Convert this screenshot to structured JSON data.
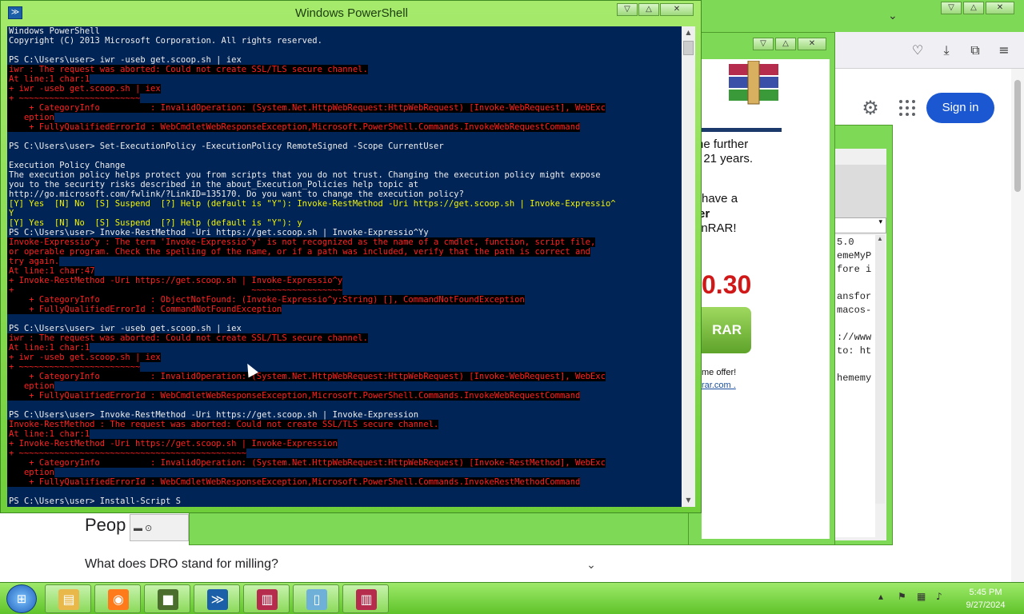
{
  "powershell": {
    "title": "Windows PowerShell",
    "icon": "powershell-icon",
    "lines": [
      {
        "t": "w",
        "text": "Windows PowerShell"
      },
      {
        "t": "w",
        "text": "Copyright (C) 2013 Microsoft Corporation. All rights reserved."
      },
      {
        "t": "w",
        "text": ""
      },
      {
        "t": "w",
        "text": "PS C:\\Users\\user> iwr -useb get.scoop.sh | iex"
      },
      {
        "t": "e",
        "text": "iwr : The request was aborted: Could not create SSL/TLS secure channel."
      },
      {
        "t": "e",
        "text": "At line:1 char:1"
      },
      {
        "t": "e",
        "text": "+ iwr -useb get.scoop.sh | iex"
      },
      {
        "t": "e",
        "text": "+ ~~~~~~~~~~~~~~~~~~~~~~~~"
      },
      {
        "t": "e",
        "text": "    + CategoryInfo          : InvalidOperation: (System.Net.HttpWebRequest:HttpWebRequest) [Invoke-WebRequest], WebExc"
      },
      {
        "t": "e",
        "text": "   eption"
      },
      {
        "t": "e",
        "text": "    + FullyQualifiedErrorId : WebCmdletWebResponseException,Microsoft.PowerShell.Commands.InvokeWebRequestCommand"
      },
      {
        "t": "w",
        "text": ""
      },
      {
        "t": "w",
        "text": "PS C:\\Users\\user> Set-ExecutionPolicy -ExecutionPolicy RemoteSigned -Scope CurrentUser"
      },
      {
        "t": "w",
        "text": ""
      },
      {
        "t": "w",
        "text": "Execution Policy Change"
      },
      {
        "t": "w",
        "text": "The execution policy helps protect you from scripts that you do not trust. Changing the execution policy might expose"
      },
      {
        "t": "w",
        "text": "you to the security risks described in the about_Execution_Policies help topic at"
      },
      {
        "t": "w",
        "text": "http://go.microsoft.com/fwlink/?LinkID=135170. Do you want to change the execution policy?"
      },
      {
        "t": "y",
        "text": "[Y] Yes  [N] No  [S] Suspend  [?] Help (default is \"Y\"): Invoke-RestMethod -Uri https://get.scoop.sh | Invoke-Expressio^"
      },
      {
        "t": "y",
        "text": "Y"
      },
      {
        "t": "y",
        "text": "[Y] Yes  [N] No  [S] Suspend  [?] Help (default is \"Y\"): y"
      },
      {
        "t": "w",
        "text": "PS C:\\Users\\user> Invoke-RestMethod -Uri https://get.scoop.sh | Invoke-Expressio^Yy"
      },
      {
        "t": "e",
        "text": "Invoke-Expressio^y : The term 'Invoke-Expressio^y' is not recognized as the name of a cmdlet, function, script file,"
      },
      {
        "t": "e",
        "text": "or operable program. Check the spelling of the name, or if a path was included, verify that the path is correct and"
      },
      {
        "t": "e",
        "text": "try again."
      },
      {
        "t": "e",
        "text": "At line:1 char:47"
      },
      {
        "t": "e",
        "text": "+ Invoke-RestMethod -Uri https://get.scoop.sh | Invoke-Expressio^y"
      },
      {
        "t": "e",
        "text": "+                                               ~~~~~~~~~~~~~~~~~~"
      },
      {
        "t": "e",
        "text": "    + CategoryInfo          : ObjectNotFound: (Invoke-Expressio^y:String) [], CommandNotFoundException"
      },
      {
        "t": "e",
        "text": "    + FullyQualifiedErrorId : CommandNotFoundException"
      },
      {
        "t": "w",
        "text": ""
      },
      {
        "t": "w",
        "text": "PS C:\\Users\\user> iwr -useb get.scoop.sh | iex"
      },
      {
        "t": "e",
        "text": "iwr : The request was aborted: Could not create SSL/TLS secure channel."
      },
      {
        "t": "e",
        "text": "At line:1 char:1"
      },
      {
        "t": "e",
        "text": "+ iwr -useb get.scoop.sh | iex"
      },
      {
        "t": "e",
        "text": "+ ~~~~~~~~~~~~~~~~~~~~~~~~"
      },
      {
        "t": "e",
        "text": "    + CategoryInfo          : InvalidOperation: (System.Net.HttpWebRequest:HttpWebRequest) [Invoke-WebRequest], WebExc"
      },
      {
        "t": "e",
        "text": "   eption"
      },
      {
        "t": "e",
        "text": "    + FullyQualifiedErrorId : WebCmdletWebResponseException,Microsoft.PowerShell.Commands.InvokeWebRequestCommand"
      },
      {
        "t": "w",
        "text": ""
      },
      {
        "t": "w",
        "text": "PS C:\\Users\\user> Invoke-RestMethod -Uri https://get.scoop.sh | Invoke-Expression"
      },
      {
        "t": "e",
        "text": "Invoke-RestMethod : The request was aborted: Could not create SSL/TLS secure channel."
      },
      {
        "t": "e",
        "text": "At line:1 char:1"
      },
      {
        "t": "e",
        "text": "+ Invoke-RestMethod -Uri https://get.scoop.sh | Invoke-Expression"
      },
      {
        "t": "e",
        "text": "+ ~~~~~~~~~~~~~~~~~~~~~~~~~~~~~~~~~~~~~~~~~~~~~"
      },
      {
        "t": "e",
        "text": "    + CategoryInfo          : InvalidOperation: (System.Net.HttpWebRequest:HttpWebRequest) [Invoke-RestMethod], WebExc"
      },
      {
        "t": "e",
        "text": "   eption"
      },
      {
        "t": "e",
        "text": "    + FullyQualifiedErrorId : WebCmdletWebResponseException,Microsoft.PowerShell.Commands.InvokeRestMethodCommand"
      },
      {
        "t": "w",
        "text": ""
      },
      {
        "t": "w",
        "text": "PS C:\\Users\\user> Install-Script S"
      }
    ],
    "colors": {
      "background": "#012456",
      "text": "#eeeeee",
      "error": "#ff2020",
      "prompt_yellow": "#f4f400"
    }
  },
  "window_buttons": {
    "minimize": "▽",
    "maximize": "△",
    "close": "✕"
  },
  "browser": {
    "signin_label": "Sign in",
    "people_heading": "Peop",
    "question": "What does DRO stand for milling?",
    "toolbar_icons": [
      "pocket-icon",
      "download-icon",
      "extensions-icon",
      "menu-icon"
    ],
    "accent": "#1a57d0"
  },
  "winrar_ad": {
    "lines": [
      "he further",
      "t 21 years.",
      "have a",
      "er",
      "inRAR!"
    ],
    "price": "0.30",
    "buy_label": "RAR",
    "offer": "me offer!",
    "link": "rar.com ."
  },
  "text_dialog": {
    "dropdown_value": "▾",
    "code_lines": [
      "5.0",
      "emeMyP",
      "fore i",
      "",
      "ansfor",
      "macos-",
      "",
      "://www",
      "to: ht",
      "",
      "hememy"
    ],
    "bottom_panel": "▬ ⊙"
  },
  "taskbar": {
    "start": "⊞",
    "apps": [
      {
        "name": "explorer",
        "glyph": "▤",
        "color": "#e8b84a"
      },
      {
        "name": "firefox",
        "glyph": "◉",
        "color": "#ff7a1a"
      },
      {
        "name": "minecraft",
        "glyph": "■",
        "color": "#4b6e2e"
      },
      {
        "name": "powershell",
        "glyph": "≫",
        "color": "#1b5fa8"
      },
      {
        "name": "winrar",
        "glyph": "▥",
        "color": "#b52c4c"
      },
      {
        "name": "notepad",
        "glyph": "▯",
        "color": "#6fb0d8"
      },
      {
        "name": "winrar-2",
        "glyph": "▥",
        "color": "#b52c4c"
      }
    ],
    "time": "5:45 PM",
    "date": "9/27/2024"
  }
}
